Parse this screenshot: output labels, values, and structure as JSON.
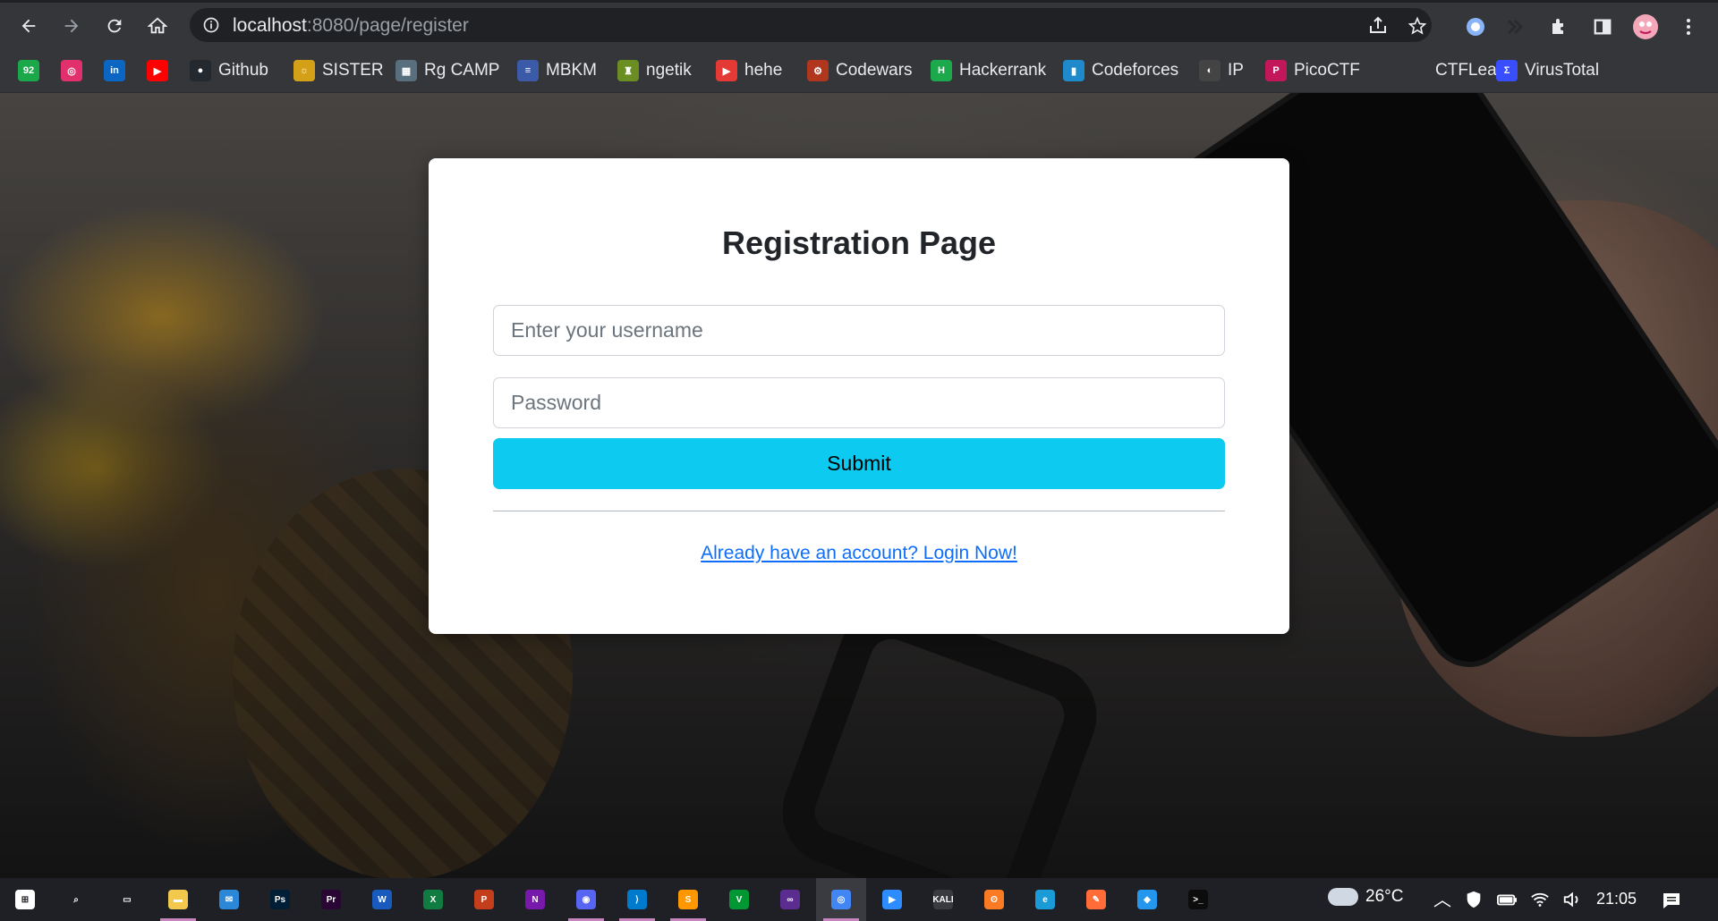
{
  "browser": {
    "url_host": "localhost",
    "url_rest": ":8080/page/register"
  },
  "bookmarks": [
    {
      "label": "",
      "icon": "nineties-badge-icon",
      "color": "#1aa84a",
      "glyph": "92"
    },
    {
      "label": "",
      "icon": "instagram-icon",
      "color": "#e1306c",
      "glyph": "◎"
    },
    {
      "label": "",
      "icon": "linkedin-icon",
      "color": "#0a66c2",
      "glyph": "in"
    },
    {
      "label": "",
      "icon": "youtube-icon",
      "color": "#ff0000",
      "glyph": "▶"
    },
    {
      "label": "Github",
      "icon": "github-icon",
      "color": "#24292f",
      "glyph": "●"
    },
    {
      "label": "SISTER",
      "icon": "sister-icon",
      "color": "#d4a017",
      "glyph": "☼"
    },
    {
      "label": "Rg CAMP",
      "icon": "rgcamp-icon",
      "color": "#5a6f7d",
      "glyph": "▦"
    },
    {
      "label": "MBKM",
      "icon": "mbkm-icon",
      "color": "#3b5aa8",
      "glyph": "≡"
    },
    {
      "label": "ngetik",
      "icon": "ngetik-icon",
      "color": "#6b8e23",
      "glyph": "♜"
    },
    {
      "label": "hehe",
      "icon": "video-icon",
      "color": "#e53935",
      "glyph": "▶"
    },
    {
      "label": "Codewars",
      "icon": "codewars-icon",
      "color": "#b1361e",
      "glyph": "⚙"
    },
    {
      "label": "Hackerrank",
      "icon": "hackerrank-icon",
      "color": "#1ba94c",
      "glyph": "H"
    },
    {
      "label": "Codeforces",
      "icon": "codeforces-icon",
      "color": "#1f8acb",
      "glyph": "▮"
    },
    {
      "label": "IP",
      "icon": "ip-globe-icon",
      "color": "#444444",
      "glyph": "◐"
    },
    {
      "label": "PicoCTF",
      "icon": "picoctf-icon",
      "color": "#c2185b",
      "glyph": "P"
    },
    {
      "label": "CTFLearn",
      "icon": "ctflearn-icon",
      "color": "#35363a",
      "glyph": ""
    },
    {
      "label": "VirusTotal",
      "icon": "virustotal-icon",
      "color": "#394eff",
      "glyph": "Σ"
    }
  ],
  "form": {
    "title": "Registration Page",
    "username_placeholder": "Enter your username",
    "password_placeholder": "Password",
    "submit_label": "Submit",
    "login_link": "Already have an account? Login Now!"
  },
  "taskbar": {
    "apps": [
      {
        "name": "start-icon",
        "color": "#ffffff",
        "glyph": "⊞"
      },
      {
        "name": "search-icon",
        "color": "#1f2025",
        "glyph": "⌕"
      },
      {
        "name": "task-view-icon",
        "color": "#1f2025",
        "glyph": "▭"
      },
      {
        "name": "file-explorer-icon",
        "color": "#f2c94c",
        "glyph": "▬",
        "running": true
      },
      {
        "name": "mail-icon",
        "color": "#2b88d8",
        "glyph": "✉"
      },
      {
        "name": "photoshop-icon",
        "color": "#001e36",
        "glyph": "Ps"
      },
      {
        "name": "premiere-icon",
        "color": "#2a0634",
        "glyph": "Pr"
      },
      {
        "name": "word-icon",
        "color": "#185abd",
        "glyph": "W"
      },
      {
        "name": "excel-icon",
        "color": "#107c41",
        "glyph": "X"
      },
      {
        "name": "powerpoint-icon",
        "color": "#c43e1c",
        "glyph": "P"
      },
      {
        "name": "onenote-icon",
        "color": "#7719aa",
        "glyph": "N"
      },
      {
        "name": "discord-icon",
        "color": "#5865f2",
        "glyph": "◉",
        "running": true
      },
      {
        "name": "vscode-icon",
        "color": "#007acc",
        "glyph": "⟩",
        "running": true
      },
      {
        "name": "sublime-icon",
        "color": "#ff9800",
        "glyph": "S",
        "running": true
      },
      {
        "name": "vim-icon",
        "color": "#019733",
        "glyph": "V"
      },
      {
        "name": "visual-studio-icon",
        "color": "#5c2d91",
        "glyph": "∞"
      },
      {
        "name": "chrome-icon",
        "color": "#4285f4",
        "glyph": "◎",
        "running": true,
        "active": true
      },
      {
        "name": "zoom-icon",
        "color": "#2d8cff",
        "glyph": "▶"
      },
      {
        "name": "kali-icon",
        "color": "#3a3b40",
        "glyph": "KALI"
      },
      {
        "name": "xampp-icon",
        "color": "#fb7a24",
        "glyph": "ʘ"
      },
      {
        "name": "edge-icon",
        "color": "#1a9ad6",
        "glyph": "e"
      },
      {
        "name": "postman-icon",
        "color": "#ff6c37",
        "glyph": "✎"
      },
      {
        "name": "docker-icon",
        "color": "#2496ed",
        "glyph": "◆"
      },
      {
        "name": "terminal-icon",
        "color": "#0c0c0c",
        "glyph": ">_"
      }
    ],
    "temperature": "26°C",
    "time": "21:05"
  }
}
